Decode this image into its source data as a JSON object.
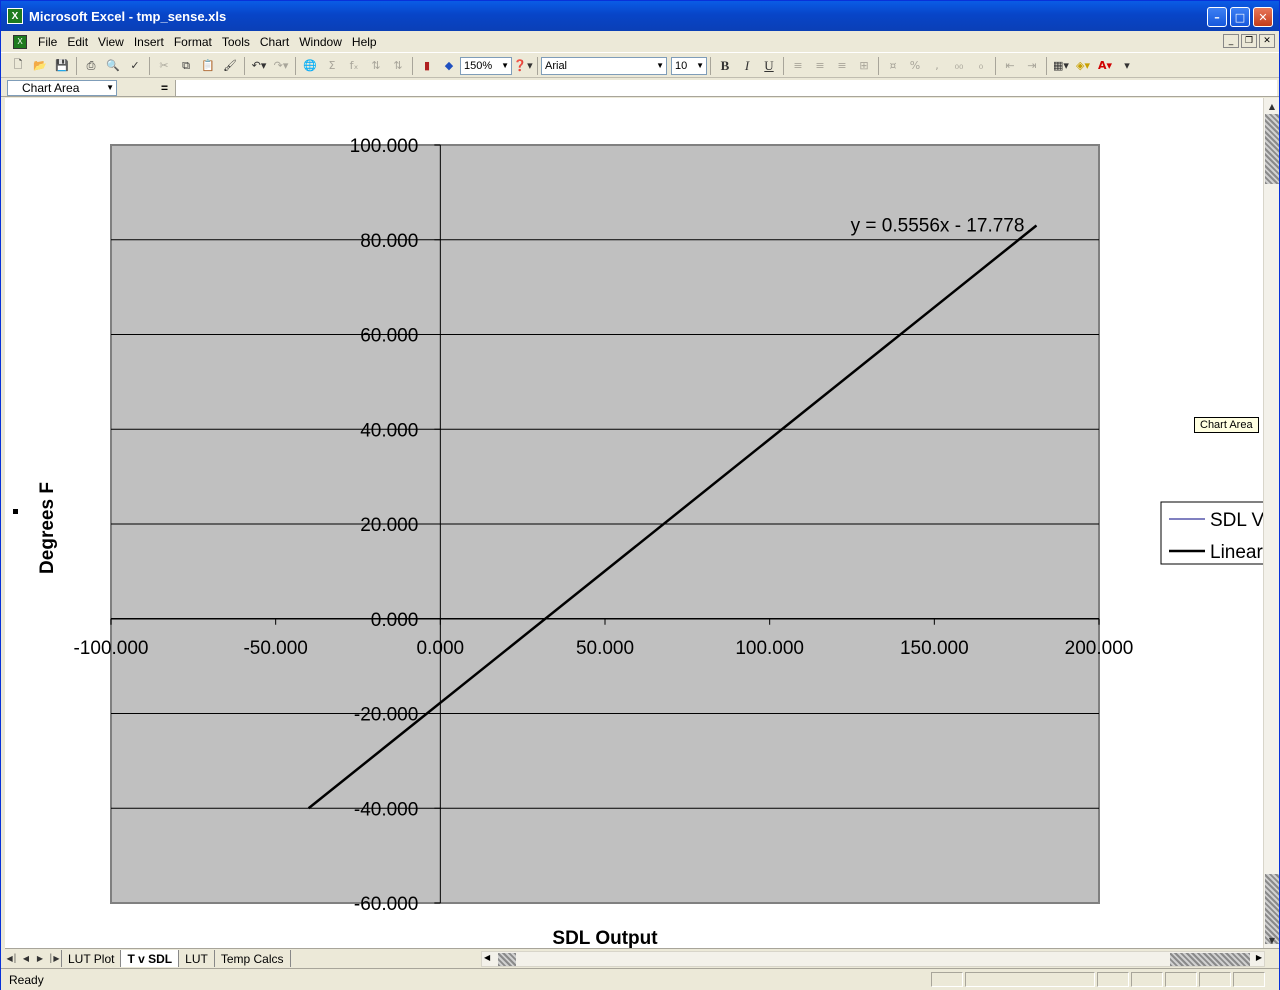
{
  "window": {
    "title": "Microsoft Excel - tmp_sense.xls"
  },
  "menu": {
    "items": [
      "File",
      "Edit",
      "View",
      "Insert",
      "Format",
      "Tools",
      "Chart",
      "Window",
      "Help"
    ]
  },
  "toolbar": {
    "zoom": "150%",
    "font": "Arial",
    "font_size": "10",
    "bold_label": "B",
    "italic_label": "I",
    "underline_label": "U"
  },
  "formula_bar": {
    "name_box": "Chart Area",
    "equals": "="
  },
  "chart_tooltip": "Chart Area",
  "sheet_tabs": [
    "LUT Plot",
    "T v SDL",
    "LUT",
    "Temp Calcs"
  ],
  "active_tab_index": 1,
  "status": {
    "text": "Ready"
  },
  "chart_data": {
    "type": "scatter",
    "xlabel": "SDL Output",
    "ylabel": "Degrees F",
    "xlim": [
      -100,
      200
    ],
    "ylim": [
      -60,
      100
    ],
    "x_ticks": [
      "-100.000",
      "-50.000",
      "0.000",
      "50.000",
      "100.000",
      "150.000",
      "200.000"
    ],
    "y_ticks": [
      "100.000",
      "80.000",
      "60.000",
      "40.000",
      "20.000",
      "0.000",
      "-20.000",
      "-40.000",
      "-60.000"
    ],
    "grid": true,
    "plot_background": "#c0c0c0",
    "series": [
      {
        "name": "SDL V",
        "x": [
          -40,
          181
        ],
        "y": [
          -40,
          83
        ],
        "color": "#000080"
      },
      {
        "name": "Linear",
        "x": [
          -40,
          181
        ],
        "y": [
          -40,
          83
        ],
        "color": "#000000"
      }
    ],
    "trendline_equation": "y = 0.5556x - 17.778",
    "legend": "right"
  }
}
